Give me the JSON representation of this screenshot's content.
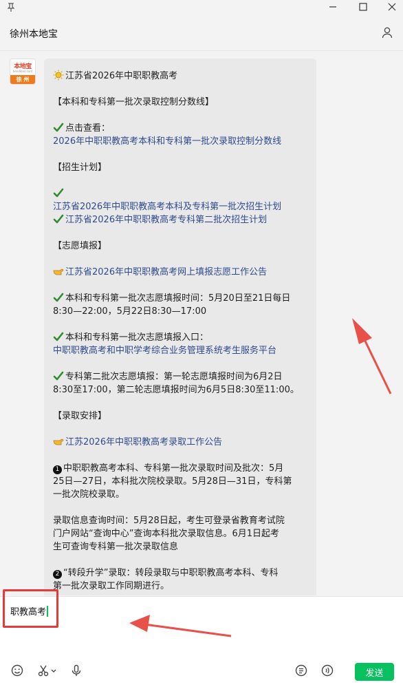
{
  "chat": {
    "title": "徐州本地宝"
  },
  "avatar": {
    "top": "本地宝",
    "sub": "bendibao.com",
    "bottom": "徐 州"
  },
  "message": {
    "lines": [
      "江苏省2026年中职职教高考",
      "【本科和专科第一批次录取控制分数线】",
      "点击查看：",
      "2026年中职职教高考本科和专科第一批次录取控制分数线",
      "【招生计划】",
      "",
      "江苏省2026年中职职教高考本科及专科第一批次招生计划",
      "江苏省2026年中职职教高考专科第二批次招生计划",
      "【志愿填报】",
      "江苏省2026年中职职教高考网上填报志愿工作公告",
      "本科和专科第一批次志愿填报时间：5月20日至21日每日",
      "8:30—22:00，5月22日8:30—17:00",
      "本科和专科第一批次志愿填报入口：",
      "中职职教高考和中职学考综合业务管理系统考生服务平台",
      "专科第二批次志愿填报：第一轮志愿填报时间为6月2日",
      "8:30至17:00，第二轮志愿填报时间为6月5日8:30至11:00。",
      "【录取安排】",
      "江苏2026年中职职教高考录取工作公告",
      "中职职教高考本科、专科第一批次录取时间及批次：5月",
      "25日—27日，本科批次院校录取。5月28日—31日，专科第",
      "一批次院校录取。",
      "录取信息查询时间：5月28日起，考生可登录省教育考试院",
      "门户网站“查询中心”查询本科批次录取信息。6月1日起考",
      "生可查询专科第一批次录取信息",
      "“转段升学”录取：转段录取与中职职教高考本科、专科",
      "第一批次录取工作同期进行。"
    ],
    "num1": "1",
    "num2": "2"
  },
  "composer": {
    "input_value": "职教高考",
    "send_label": "发送"
  },
  "colors": {
    "link": "#2e4a8c",
    "send": "#07c160",
    "annotation": "#e63a3a",
    "bubble": "#e9e9ea"
  }
}
